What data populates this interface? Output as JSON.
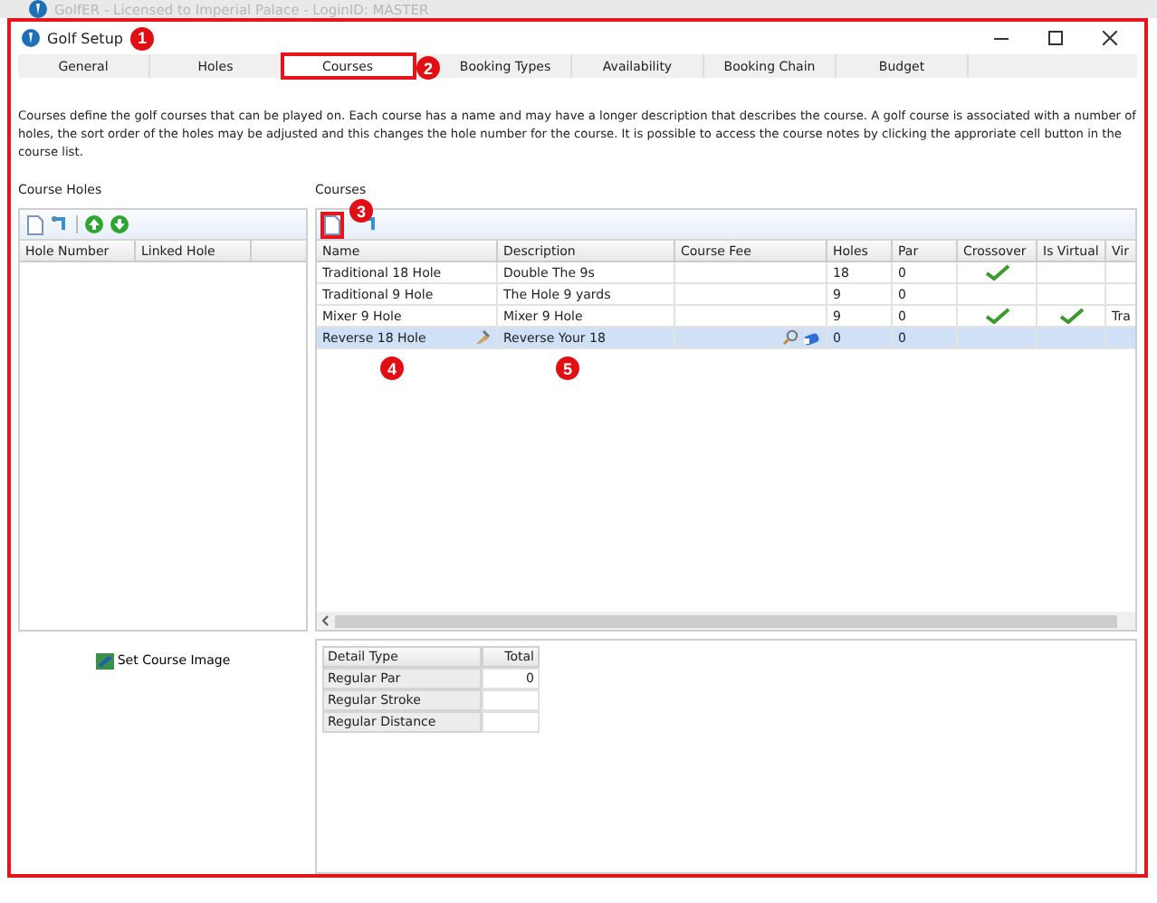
{
  "outer_window": {
    "title": "GolfER - Licensed to Imperial Palace - LoginID: MASTER"
  },
  "window": {
    "title": "Golf Setup",
    "callout": "1"
  },
  "tabs": [
    {
      "label": "General",
      "selected": false
    },
    {
      "label": "Holes",
      "selected": false
    },
    {
      "label": "Courses",
      "selected": true,
      "callout": "2"
    },
    {
      "label": "Booking Types",
      "selected": false
    },
    {
      "label": "Availability",
      "selected": false
    },
    {
      "label": "Booking Chain",
      "selected": false
    },
    {
      "label": "Budget",
      "selected": false
    }
  ],
  "description": "Courses define the golf courses that can be played on. Each course has a name and may have a longer description that describes the course. A golf course is associated with a number of holes, the sort order of the holes may be adjusted and this changes the hole number for the course. It is possible to access the course notes by clicking the approriate cell button in the course list.",
  "course_holes": {
    "label": "Course Holes",
    "columns": [
      "Hole Number",
      "Linked Hole"
    ]
  },
  "courses": {
    "label": "Courses",
    "toolbar_callout": "3",
    "name_callout": "4",
    "description_callout": "5",
    "columns": [
      "Name",
      "Description",
      "Course Fee",
      "Holes",
      "Par",
      "Crossover",
      "Is Virtual",
      "Vir"
    ],
    "rows": [
      {
        "name": "Traditional 18 Hole",
        "description": "Double The 9s",
        "holes": "18",
        "par": "0",
        "crossover": true,
        "is_virtual": false,
        "column_8": "",
        "selected": false
      },
      {
        "name": "Traditional 9 Hole",
        "description": "The Hole 9 yards",
        "holes": "9",
        "par": "0",
        "crossover": false,
        "is_virtual": false,
        "column_8": "",
        "selected": false
      },
      {
        "name": "Mixer 9 Hole",
        "description": "Mixer 9 Hole",
        "holes": "9",
        "par": "0",
        "crossover": true,
        "is_virtual": true,
        "column_8": "Tra",
        "selected": false
      },
      {
        "name": "Reverse 18 Hole",
        "description": "Reverse Your 18",
        "holes": "0",
        "par": "0",
        "crossover": false,
        "is_virtual": false,
        "column_8": "",
        "selected": true
      }
    ]
  },
  "set_course_image": "Set Course Image",
  "details": {
    "columns": [
      "Detail Type",
      "Total"
    ],
    "rows": [
      {
        "type": "Regular Par",
        "total": "0"
      },
      {
        "type": "Regular Stroke",
        "total": ""
      },
      {
        "type": "Regular Distance",
        "total": ""
      }
    ]
  }
}
